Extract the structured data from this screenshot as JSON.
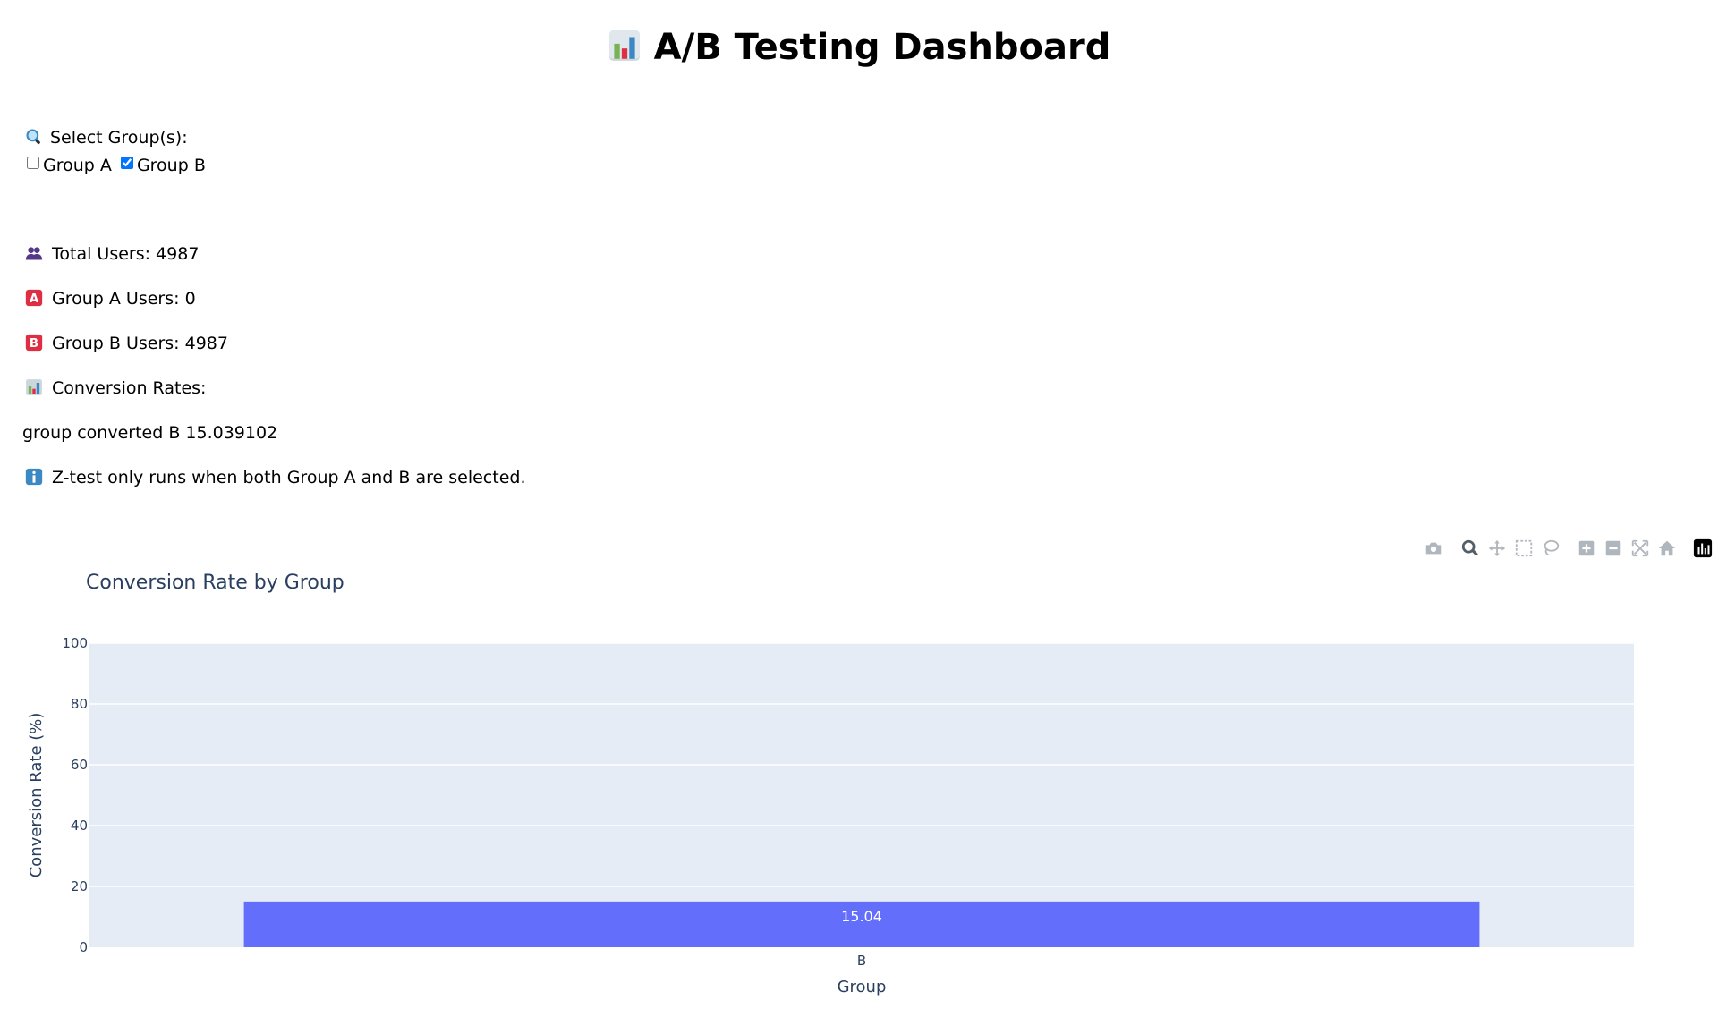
{
  "header": {
    "title": "A/B Testing Dashboard",
    "icon": "bar-chart-emoji"
  },
  "controls": {
    "label": "Select Group(s):",
    "options": [
      {
        "label": "Group A",
        "checked": false
      },
      {
        "label": "Group B",
        "checked": true
      }
    ]
  },
  "stats": {
    "total_users": "Total Users: 4987",
    "group_a_users": "Group A Users: 0",
    "group_b_users": "Group B Users: 4987",
    "conversion_heading": "Conversion Rates:",
    "conversion_row": "group converted B 15.039102",
    "ztest_note": "Z-test only runs when both Group A and B are selected."
  },
  "modebar": {
    "buttons": [
      "camera-icon",
      "zoom-icon",
      "pan-icon",
      "box-select-icon",
      "lasso-icon",
      "zoom-in-icon",
      "zoom-out-icon",
      "autoscale-icon",
      "reset-axes-icon",
      "plotly-logo-icon"
    ]
  },
  "colors": {
    "bar": "#636efa",
    "plot_bg": "#e5ecf6",
    "axis_text": "#2a3f5f"
  },
  "chart_data": {
    "type": "bar",
    "title": "Conversion Rate by Group",
    "xlabel": "Group",
    "ylabel": "Conversion Rate (%)",
    "categories": [
      "B"
    ],
    "values": [
      15.04
    ],
    "data_labels": [
      "15.04"
    ],
    "ylim": [
      0,
      100
    ],
    "yticks": [
      0,
      20,
      40,
      60,
      80,
      100
    ],
    "grid": true,
    "legend": "none"
  }
}
